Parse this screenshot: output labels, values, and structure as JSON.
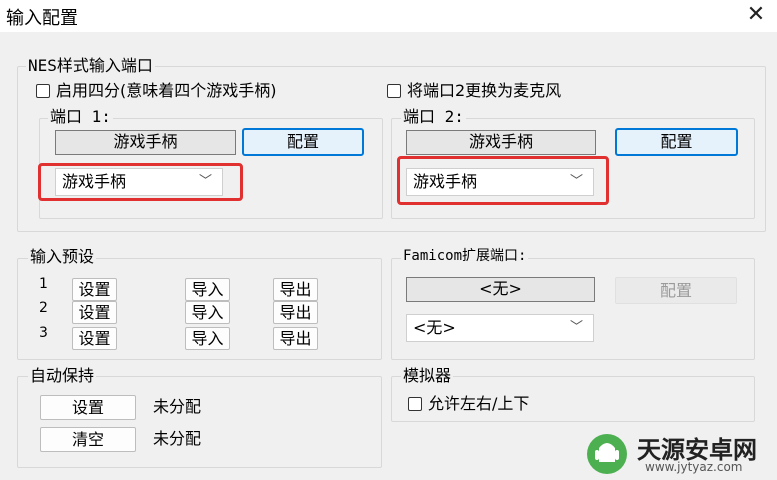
{
  "window": {
    "title": "输入配置",
    "close_glyph": "✕"
  },
  "nes_ports": {
    "group_label": "NES样式输入端口",
    "fourscore_label": "启用四分(意味着四个游戏手柄)",
    "mic_label": "将端口2更换为麦克风",
    "port1": {
      "label": "端口 1:",
      "device_display": "游戏手柄",
      "config_label": "配置",
      "select_value": "游戏手柄"
    },
    "port2": {
      "label": "端口 2:",
      "device_display": "游戏手柄",
      "config_label": "配置",
      "select_value": "游戏手柄"
    }
  },
  "presets": {
    "group_label": "输入预设",
    "rows": [
      {
        "num": "1",
        "set": "设置",
        "import": "导入",
        "export": "导出"
      },
      {
        "num": "2",
        "set": "设置",
        "import": "导入",
        "export": "导出"
      },
      {
        "num": "3",
        "set": "设置",
        "import": "导入",
        "export": "导出"
      }
    ]
  },
  "famicom": {
    "group_label": "Famicom扩展端口:",
    "device_display": "<无>",
    "config_label": "配置",
    "select_value": "<无>"
  },
  "autohold": {
    "group_label": "自动保持",
    "set_label": "设置",
    "set_status": "未分配",
    "clear_label": "清空",
    "clear_status": "未分配"
  },
  "emulator": {
    "group_label": "模拟器",
    "allow_lr_label": "允许左右/上下"
  },
  "watermark": {
    "brand": "天源安卓网",
    "url": "www.jytyaz.com"
  },
  "colors": {
    "highlight": "#e03030",
    "accent": "#0078d7"
  }
}
